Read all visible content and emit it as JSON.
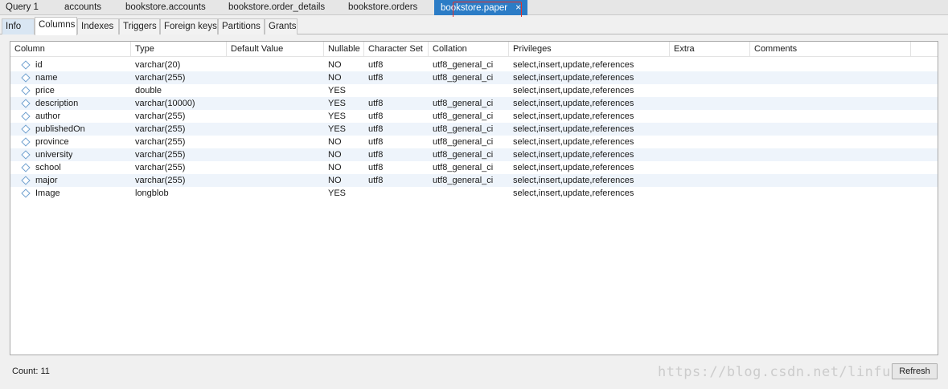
{
  "doc_tabs": [
    {
      "label": "Query 1",
      "active": false
    },
    {
      "label": "accounts",
      "active": false
    },
    {
      "label": "bookstore.accounts",
      "active": false
    },
    {
      "label": "bookstore.order_details",
      "active": false
    },
    {
      "label": "bookstore.orders",
      "active": false
    },
    {
      "label": "bookstore.paper",
      "active": true
    }
  ],
  "active_tab_close": "×",
  "sub_tabs": [
    "Info",
    "Columns",
    "Indexes",
    "Triggers",
    "Foreign keys",
    "Partitions",
    "Grants"
  ],
  "active_sub_tab": "Columns",
  "grid": {
    "headers": [
      "Column",
      "Type",
      "Default Value",
      "Nullable",
      "Character Set",
      "Collation",
      "Privileges",
      "Extra",
      "Comments"
    ],
    "rows": [
      [
        "id",
        "varchar(20)",
        "",
        "NO",
        "utf8",
        "utf8_general_ci",
        "select,insert,update,references",
        "",
        ""
      ],
      [
        "name",
        "varchar(255)",
        "",
        "NO",
        "utf8",
        "utf8_general_ci",
        "select,insert,update,references",
        "",
        ""
      ],
      [
        "price",
        "double",
        "",
        "YES",
        "",
        "",
        "select,insert,update,references",
        "",
        ""
      ],
      [
        "description",
        "varchar(10000)",
        "",
        "YES",
        "utf8",
        "utf8_general_ci",
        "select,insert,update,references",
        "",
        ""
      ],
      [
        "author",
        "varchar(255)",
        "",
        "YES",
        "utf8",
        "utf8_general_ci",
        "select,insert,update,references",
        "",
        ""
      ],
      [
        "publishedOn",
        "varchar(255)",
        "",
        "YES",
        "utf8",
        "utf8_general_ci",
        "select,insert,update,references",
        "",
        ""
      ],
      [
        "province",
        "varchar(255)",
        "",
        "NO",
        "utf8",
        "utf8_general_ci",
        "select,insert,update,references",
        "",
        ""
      ],
      [
        "university",
        "varchar(255)",
        "",
        "NO",
        "utf8",
        "utf8_general_ci",
        "select,insert,update,references",
        "",
        ""
      ],
      [
        "school",
        "varchar(255)",
        "",
        "NO",
        "utf8",
        "utf8_general_ci",
        "select,insert,update,references",
        "",
        ""
      ],
      [
        "major",
        "varchar(255)",
        "",
        "NO",
        "utf8",
        "utf8_general_ci",
        "select,insert,update,references",
        "",
        ""
      ],
      [
        "Image",
        "longblob",
        "",
        "YES",
        "",
        "",
        "select,insert,update,references",
        "",
        ""
      ]
    ],
    "row_icon": "column-diamond-icon"
  },
  "footer": {
    "count": "Count: 11",
    "refresh_label": "Refresh"
  },
  "watermark": "https://blog.csdn.net/linfujian",
  "colors": {
    "active_tab": "#2b7cc6",
    "highlight_box": "#e5302a",
    "alt_row": "#eef4fb"
  }
}
